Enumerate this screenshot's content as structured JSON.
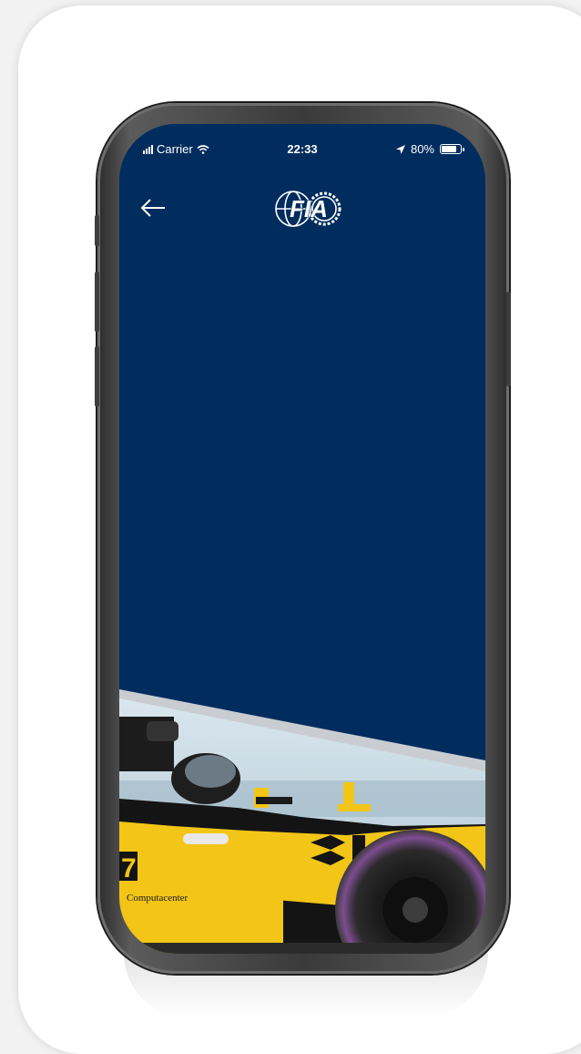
{
  "status_bar": {
    "carrier": "Carrier",
    "time": "22:33",
    "battery_percent": "80%",
    "battery_level": 0.8
  },
  "header": {
    "back_icon": "arrow-left-icon",
    "logo_text": "FIA"
  },
  "hero": {
    "car_sponsor_text": "Computacenter",
    "car_number": "7",
    "colors": {
      "background": "#012c5e",
      "car_yellow": "#f2c517"
    }
  }
}
